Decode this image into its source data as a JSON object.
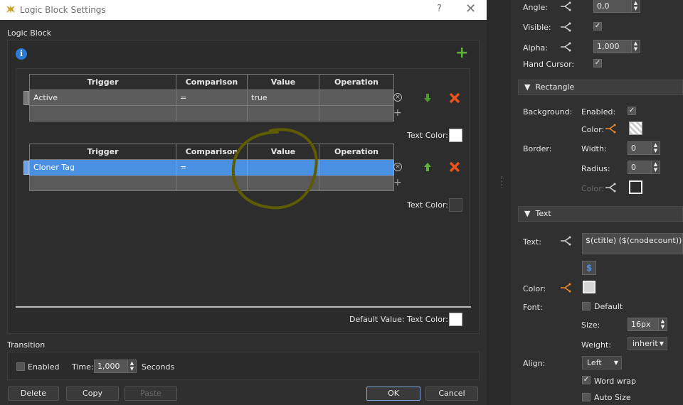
{
  "dialog": {
    "title": "Logic Block Settings",
    "help_glyph": "?",
    "close_glyph": "✕",
    "section_label": "Logic Block",
    "info_glyph": "i",
    "add_glyph": "+",
    "tables": [
      {
        "headers": [
          "Trigger",
          "Comparison",
          "Value",
          "Operation"
        ],
        "row": [
          "Active",
          "=",
          "true",
          ""
        ],
        "text_color_label": "Text Color:"
      },
      {
        "headers": [
          "Trigger",
          "Comparison",
          "Value",
          "Operation"
        ],
        "row": [
          "Cloner Tag",
          "=",
          "",
          ""
        ],
        "text_color_label": "Text Color:"
      }
    ],
    "default_value_label": "Default Value:",
    "default_text_color_label": "Text Color:",
    "transition": {
      "label": "Transition",
      "enabled_label": "Enabled",
      "time_label": "Time:",
      "time_value": "1,000",
      "seconds_label": "Seconds"
    },
    "buttons": {
      "delete": "Delete",
      "copy": "Copy",
      "paste": "Paste",
      "ok": "OK",
      "cancel": "Cancel"
    }
  },
  "inspector": {
    "angle_label": "Angle:",
    "angle_value": "0,0",
    "visible_label": "Visible:",
    "alpha_label": "Alpha:",
    "alpha_value": "1,000",
    "hand_cursor_label": "Hand Cursor:",
    "rectangle_header": "Rectangle",
    "background_label": "Background:",
    "enabled_label": "Enabled:",
    "color_label": "Color:",
    "border_label": "Border:",
    "width_label": "Width:",
    "width_value": "0",
    "radius_label": "Radius:",
    "radius_value": "0",
    "border_color_label": "Color:",
    "text_header": "Text",
    "text_label": "Text:",
    "text_value": "$(ctitle) ($(cnodecount))",
    "text_color_label": "Color:",
    "font_label": "Font:",
    "default_label": "Default",
    "size_label": "Size:",
    "size_value": "16px",
    "weight_label": "Weight:",
    "weight_value": "inherit",
    "align_label": "Align:",
    "align_value": "Left",
    "word_wrap_label": "Word wrap",
    "auto_size_label": "Auto Size",
    "dollar_glyph": "$"
  },
  "colors": {
    "selected_row": "#4a90e2",
    "add_green": "#5fb33a",
    "delete_orange": "#e8541e",
    "annotation": "#6b6a00",
    "accent_orange": "#f08a2a"
  }
}
